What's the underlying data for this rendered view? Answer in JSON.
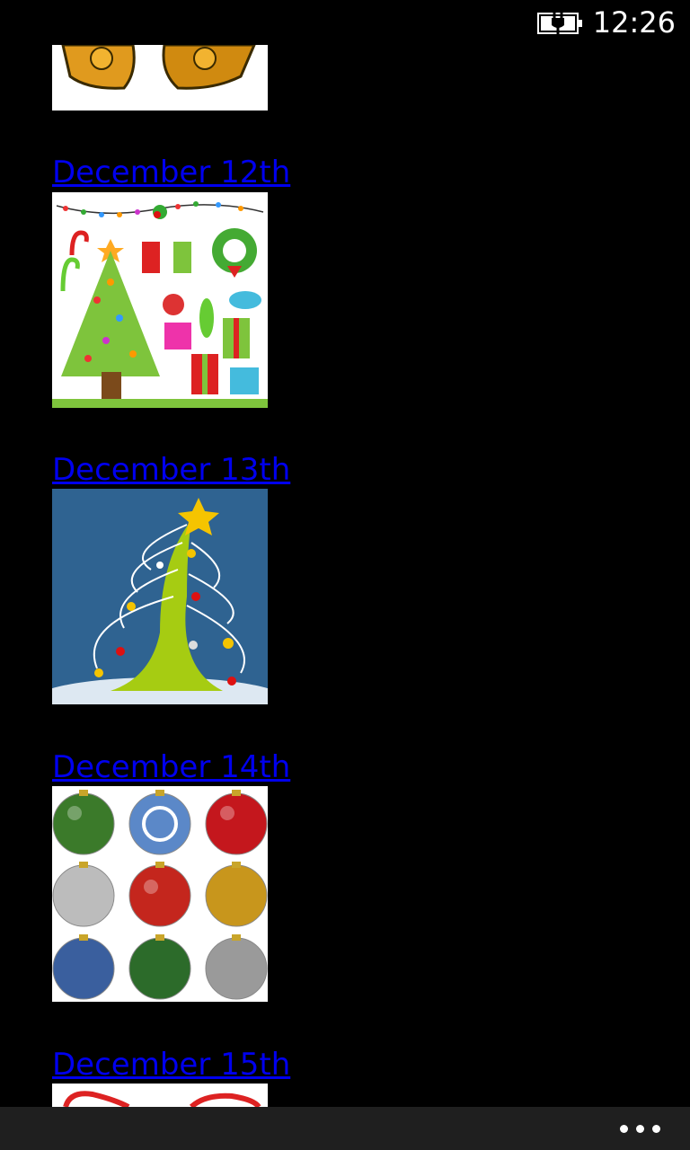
{
  "status_bar": {
    "time": "12:26",
    "battery_icon": "battery-charging-icon"
  },
  "feed": {
    "entries": [
      {
        "label": "December 12th",
        "image_icon": "christmas-clipart-image"
      },
      {
        "label": "December 13th",
        "image_icon": "swirl-tree-image"
      },
      {
        "label": "December 14th",
        "image_icon": "ornaments-image"
      },
      {
        "label": "December 15th",
        "image_icon": "candy-cane-image"
      }
    ]
  },
  "app_bar": {
    "more_icon": "ellipsis-icon"
  }
}
